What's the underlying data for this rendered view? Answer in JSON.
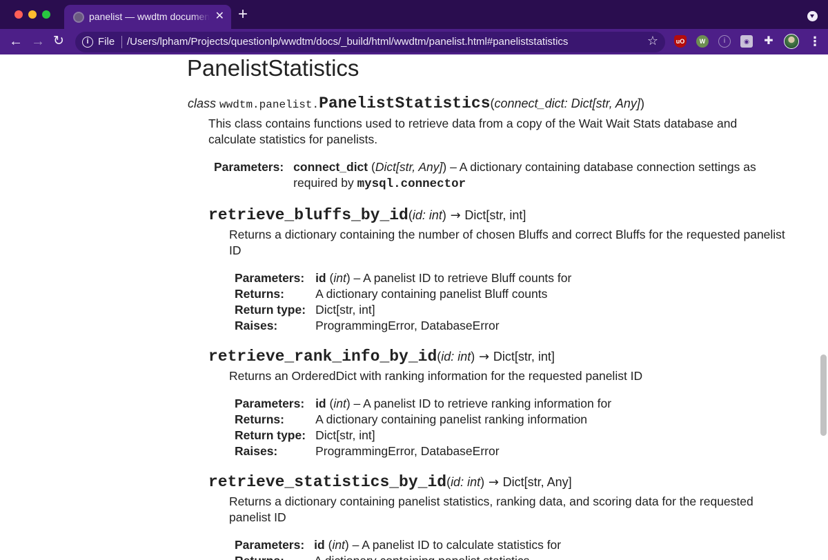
{
  "browser": {
    "tab_title": "panelist — wwdtm documentation",
    "scheme": "File",
    "url": "/Users/lpham/Projects/questionlp/wwdtm/docs/_build/html/wwdtm/panelist.html#paneliststatistics"
  },
  "doc": {
    "section_title": "PanelistStatistics",
    "class": {
      "keyword": "class",
      "prename": "wwdtm.panelist.",
      "name": "PanelistStatistics",
      "param": "connect_dict: Dict[str, Any]",
      "description": "This class contains functions used to retrieve data from a copy of the Wait Wait Stats database and calculate statistics for panelists.",
      "params_label": "Parameters:",
      "param_name": "connect_dict",
      "param_type": "Dict[str, Any]",
      "param_desc": " – A dictionary containing database connection settings as required by ",
      "param_code": "mysql.connector"
    },
    "methods": [
      {
        "name": "retrieve_bluffs_by_id",
        "param": "id: int",
        "return_sig": "Dict[str, int]",
        "description": "Returns a dictionary containing the number of chosen Bluffs and correct Bluffs for the requested panelist ID",
        "param_name": "id",
        "param_type": "int",
        "param_desc": " – A panelist ID to retrieve Bluff counts for",
        "returns": "A dictionary containing panelist Bluff counts",
        "return_type": "Dict[str, int]",
        "raises": "ProgrammingError, DatabaseError"
      },
      {
        "name": "retrieve_rank_info_by_id",
        "param": "id: int",
        "return_sig": "Dict[str, int]",
        "description": "Returns an OrderedDict with ranking information for the requested panelist ID",
        "param_name": "id",
        "param_type": "int",
        "param_desc": " – A panelist ID to retrieve ranking information for",
        "returns": "A dictionary containing panelist ranking information",
        "return_type": "Dict[str, int]",
        "raises": "ProgrammingError, DatabaseError"
      },
      {
        "name": "retrieve_statistics_by_id",
        "param": "id: int",
        "return_sig": "Dict[str, Any]",
        "description": "Returns a dictionary containing panelist statistics, ranking data, and scoring data for the requested panelist ID",
        "param_name": "id",
        "param_type": "int",
        "param_desc": " – A panelist ID to calculate statistics for",
        "returns": "A dictionary containing panelist statistics"
      }
    ],
    "labels": {
      "parameters": "Parameters:",
      "returns": "Returns:",
      "return_type": "Return type:",
      "raises": "Raises:",
      "arrow": " → "
    }
  }
}
